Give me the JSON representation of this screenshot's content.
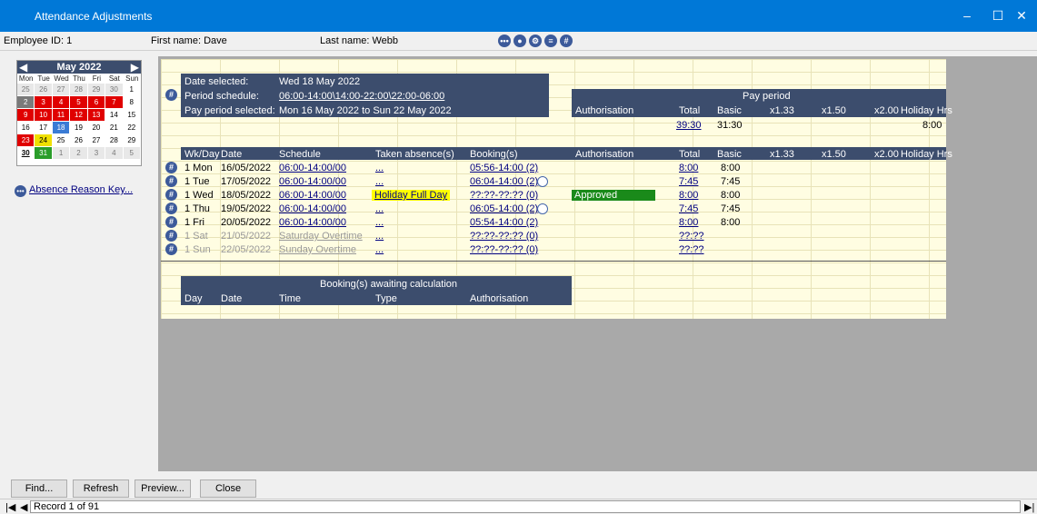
{
  "window": {
    "title": "Attendance Adjustments",
    "min": "–",
    "max": "☐",
    "close": "✕"
  },
  "info": {
    "employee_label": "Employee ID: 1",
    "first_name_label": "First name: Dave",
    "last_name_label": "Last name: Webb"
  },
  "calendar": {
    "month": "May 2022",
    "days": [
      "Mon",
      "Tue",
      "Wed",
      "Thu",
      "Fri",
      "Sat",
      "Sun"
    ],
    "cells": [
      "25",
      "26",
      "27",
      "28",
      "29",
      "30",
      "1",
      "2",
      "3",
      "4",
      "5",
      "6",
      "7",
      "8",
      "9",
      "10",
      "11",
      "12",
      "13",
      "14",
      "15",
      "16",
      "17",
      "18",
      "19",
      "20",
      "21",
      "22",
      "23",
      "24",
      "25",
      "26",
      "27",
      "28",
      "29",
      "30",
      "31",
      "1",
      "2",
      "3",
      "4",
      "5"
    ]
  },
  "absence_key": "Absence Reason Key...",
  "summary": {
    "date_selected_label": "Date selected:",
    "date_selected": "Wed 18 May 2022",
    "period_schedule_label": "Period schedule:",
    "period_schedule": "06:00-14:00\\14:00-22:00\\22:00-06:00",
    "pay_period_label": "Pay period selected:",
    "pay_period": "Mon 16 May 2022 to Sun 22 May 2022"
  },
  "pay": {
    "title": "Pay period",
    "cols": [
      "Authorisation",
      "Total",
      "Basic",
      "x1.33",
      "x1.50",
      "x2.00",
      "Holiday Hrs"
    ],
    "total": "39:30",
    "basic": "31:30",
    "holiday": "8:00"
  },
  "table": {
    "headers": [
      "Wk/Day",
      "Date",
      "Schedule",
      "Taken absence(s)",
      "Booking(s)",
      "Authorisation",
      "Total",
      "Basic",
      "x1.33",
      "x1.50",
      "x2.00",
      "Holiday Hrs"
    ],
    "rows": [
      {
        "day": "1 Mon",
        "date": "16/05/2022",
        "schedule": "06:00-14:00/00",
        "absence": "...",
        "booking": "05:56-14:00 (2)",
        "auth": "",
        "total": "8:00",
        "basic": "8:00"
      },
      {
        "day": "1 Tue",
        "date": "17/05/2022",
        "schedule": "06:00-14:00/00",
        "absence": "...",
        "booking": "06:04-14:00 (2)",
        "auth": "",
        "total": "7:45",
        "basic": "7:45"
      },
      {
        "day": "1 Wed",
        "date": "18/05/2022",
        "schedule": "06:00-14:00/00",
        "absence": "Holiday Full Day",
        "booking": "??:??-??:?? (0)",
        "auth": "Approved",
        "total": "8:00",
        "basic": "8:00"
      },
      {
        "day": "1 Thu",
        "date": "19/05/2022",
        "schedule": "06:00-14:00/00",
        "absence": "...",
        "booking": "06:05-14:00 (2)",
        "auth": "",
        "total": "7:45",
        "basic": "7:45"
      },
      {
        "day": "1 Fri",
        "date": "20/05/2022",
        "schedule": "06:00-14:00/00",
        "absence": "...",
        "booking": "05:54-14:00 (2)",
        "auth": "",
        "total": "8:00",
        "basic": "8:00"
      },
      {
        "day": "1 Sat",
        "date": "21/05/2022",
        "schedule": "Saturday Overtime",
        "absence": "...",
        "booking": "??:??-??:?? (0)",
        "auth": "",
        "total": "??:??",
        "basic": ""
      },
      {
        "day": "1 Sun",
        "date": "22/05/2022",
        "schedule": "Sunday Overtime",
        "absence": "...",
        "booking": "??:??-??:?? (0)",
        "auth": "",
        "total": "??:??",
        "basic": ""
      }
    ]
  },
  "awaiting": {
    "title": "Booking(s) awaiting calculation",
    "cols": [
      "Day",
      "Date",
      "Time",
      "Type",
      "Authorisation"
    ]
  },
  "buttons": {
    "find": "Find...",
    "refresh": "Refresh",
    "preview": "Preview...",
    "close": "Close"
  },
  "record": "Record 1 of 91"
}
